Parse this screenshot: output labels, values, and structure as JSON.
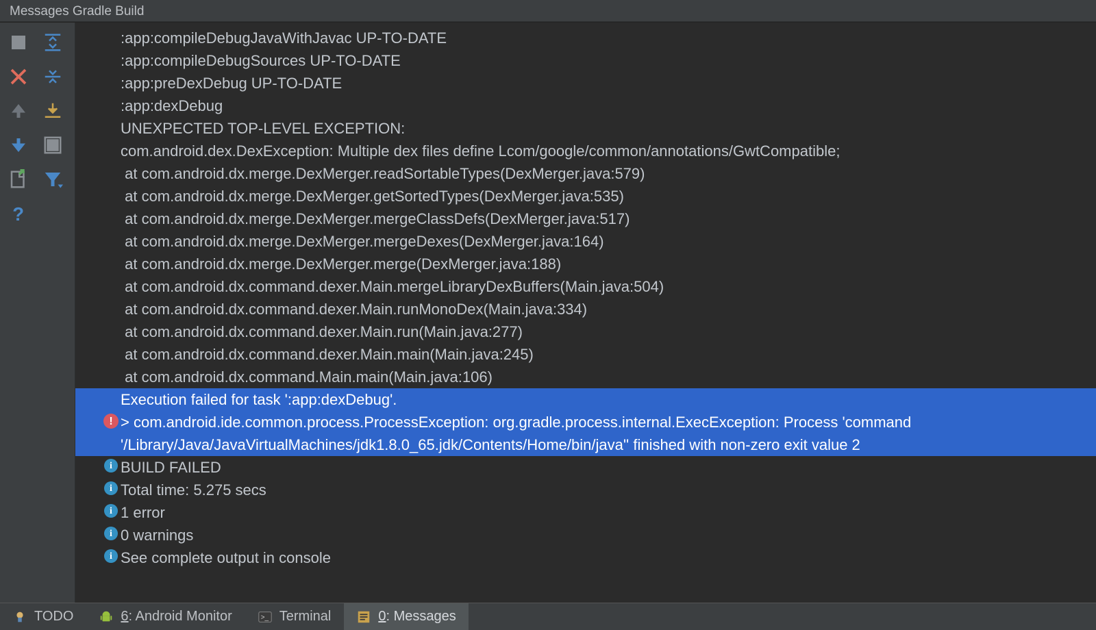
{
  "title": "Messages Gradle Build",
  "output": {
    "plain": [
      ":app:compileDebugJavaWithJavac UP-TO-DATE",
      ":app:compileDebugSources UP-TO-DATE",
      ":app:preDexDebug UP-TO-DATE",
      ":app:dexDebug",
      "UNEXPECTED TOP-LEVEL EXCEPTION:",
      "com.android.dex.DexException: Multiple dex files define Lcom/google/common/annotations/GwtCompatible;",
      " at com.android.dx.merge.DexMerger.readSortableTypes(DexMerger.java:579)",
      " at com.android.dx.merge.DexMerger.getSortedTypes(DexMerger.java:535)",
      " at com.android.dx.merge.DexMerger.mergeClassDefs(DexMerger.java:517)",
      " at com.android.dx.merge.DexMerger.mergeDexes(DexMerger.java:164)",
      " at com.android.dx.merge.DexMerger.merge(DexMerger.java:188)",
      " at com.android.dx.command.dexer.Main.mergeLibraryDexBuffers(Main.java:504)",
      " at com.android.dx.command.dexer.Main.runMonoDex(Main.java:334)",
      " at com.android.dx.command.dexer.Main.run(Main.java:277)",
      " at com.android.dx.command.dexer.Main.main(Main.java:245)",
      " at com.android.dx.command.Main.main(Main.java:106)"
    ],
    "selected_header": "Execution failed for task ':app:dexDebug'.",
    "selected_error": "> com.android.ide.common.process.ProcessException: org.gradle.process.internal.ExecException: Process 'command '/Library/Java/JavaVirtualMachines/jdk1.8.0_65.jdk/Contents/Home/bin/java'' finished with non-zero exit value 2",
    "info": [
      "BUILD FAILED",
      "Total time: 5.275 secs",
      "1 error",
      "0 warnings",
      "See complete output in console"
    ]
  },
  "bottom": {
    "todo": "TODO",
    "android_num": "6",
    "android_label": ": Android Monitor",
    "terminal": "Terminal",
    "messages_num": "0",
    "messages_label": ": Messages"
  }
}
